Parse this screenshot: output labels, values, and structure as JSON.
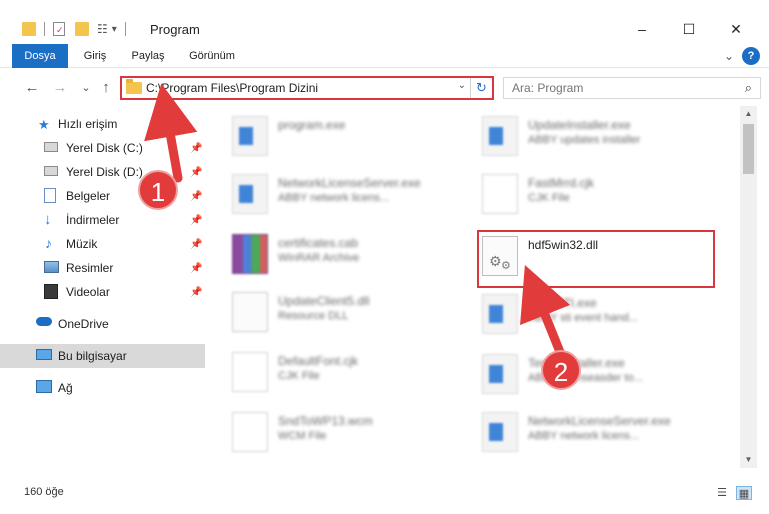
{
  "window": {
    "title": "Program",
    "minimize": "–",
    "maximize": "☐",
    "close": "✕"
  },
  "ribbon": {
    "tabs": [
      "Dosya",
      "Giriş",
      "Paylaş",
      "Görünüm"
    ],
    "collapse": "⌄",
    "help": "?"
  },
  "nav": {
    "back": "←",
    "forward": "→",
    "recent": "⌄",
    "up": "↑"
  },
  "address": {
    "path": "C:\\Program Files\\Program Dizini",
    "dropdown": "⌄",
    "refresh": "↻"
  },
  "search": {
    "placeholder": "Ara: Program",
    "icon": "⌕"
  },
  "sidebar": {
    "quick_access": "Hızlı erişim",
    "items": [
      {
        "label": "Yerel Disk (C:)",
        "icon": "drive-icon"
      },
      {
        "label": "Yerel Disk (D:)",
        "icon": "drive-icon"
      },
      {
        "label": "Belgeler",
        "icon": "documents-icon"
      },
      {
        "label": "İndirmeler",
        "icon": "download-icon"
      },
      {
        "label": "Müzik",
        "icon": "music-icon"
      },
      {
        "label": "Resimler",
        "icon": "pictures-icon"
      },
      {
        "label": "Videolar",
        "icon": "videos-icon"
      }
    ],
    "onedrive": "OneDrive",
    "this_pc": "Bu bilgisayar",
    "network": "Ağ"
  },
  "files": {
    "left": [
      {
        "name": "program.exe",
        "desc": "",
        "type": "exe"
      },
      {
        "name": "NetworkLicenseServer.exe",
        "desc": "ABBY network licens...",
        "type": "exe"
      },
      {
        "name": "certificates.cab",
        "desc": "WinRAR Archive",
        "type": "rar"
      },
      {
        "name": "UpdateClient5.dll",
        "desc": "Resource DLL",
        "type": "dll"
      },
      {
        "name": "DefaultFont.cjk",
        "desc": "CJK File",
        "type": "doc"
      },
      {
        "name": "SndToWP13.wcm",
        "desc": "WCM File",
        "type": "doc"
      }
    ],
    "right": [
      {
        "name": "UpdateInstaller.exe",
        "desc": "ABBY updates installer",
        "type": "exe"
      },
      {
        "name": "FastMrrd.cjk",
        "desc": "CJK File",
        "type": "doc"
      },
      {
        "name": "hdf5win32.dll",
        "desc": "",
        "type": "dllgear"
      },
      {
        "name": "AbbySTI.exe",
        "desc": "ABBY sti event hand...",
        "type": "exe"
      },
      {
        "name": "TermsInstaller.exe",
        "desc": "ABBY Transeasder to...",
        "type": "exe"
      },
      {
        "name": "NetworkLicenseServer.exe",
        "desc": "ABBY network licens...",
        "type": "exe"
      }
    ]
  },
  "status": {
    "count": "160 öğe"
  },
  "annotations": {
    "one": "1",
    "two": "2"
  },
  "colors": {
    "accent": "#1a6fc5",
    "highlight": "#d9363e"
  }
}
